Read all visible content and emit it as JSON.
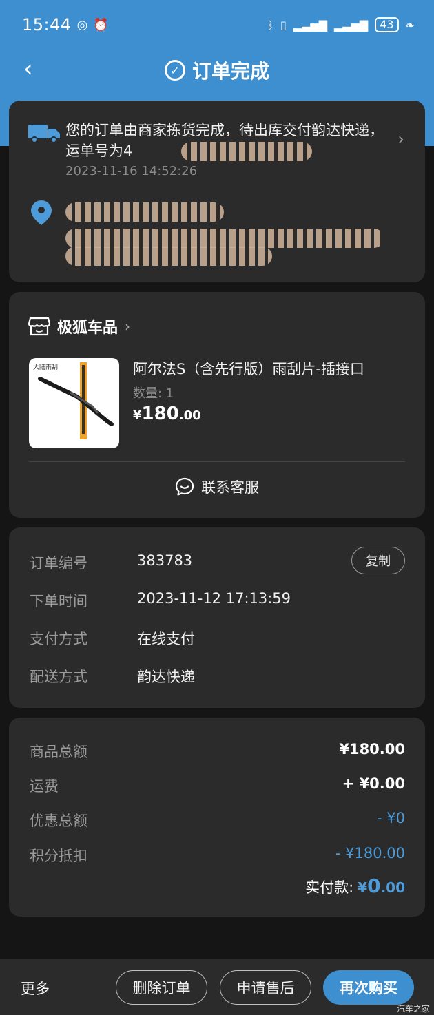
{
  "status_bar": {
    "time": "15:44",
    "battery": "43"
  },
  "header": {
    "title": "订单完成"
  },
  "logistics": {
    "message": "您的订单由商家拣货完成，待出库交付韵达快递，运单号为4",
    "timestamp": "2023-11-16 14:52:26"
  },
  "store": {
    "name": "极狐车品"
  },
  "product": {
    "name": "阿尔法S（含先行版）雨刮片-插接口",
    "quantity": "数量: 1",
    "price_currency": "¥",
    "price_int": "180",
    "price_dec": ".00",
    "image_label": "大陆雨刮"
  },
  "contact_service": "联系客服",
  "order_info": {
    "copy_label": "复制",
    "rows": [
      {
        "label": "订单编号",
        "value": "383783"
      },
      {
        "label": "下单时间",
        "value": "2023-11-12 17:13:59"
      },
      {
        "label": "支付方式",
        "value": "在线支付"
      },
      {
        "label": "配送方式",
        "value": "韵达快递"
      }
    ]
  },
  "amounts": {
    "rows": [
      {
        "label": "商品总额",
        "value": "¥180.00"
      },
      {
        "label": "运费",
        "value": "+ ¥0.00"
      },
      {
        "label": "优惠总额",
        "value": "- ¥0"
      },
      {
        "label": "积分抵扣",
        "value": "- ¥180.00"
      }
    ],
    "paid_label": "实付款:",
    "paid_currency": "¥",
    "paid_int": "0",
    "paid_dec": ".00"
  },
  "bottom_bar": {
    "more": "更多",
    "delete": "删除订单",
    "after_sale": "申请售后",
    "buy_again": "再次购买"
  },
  "watermark": "汽车之家",
  "colors": {
    "accent": "#3d8fd0",
    "card": "#2b2b2b",
    "price_blue": "#4d9bd8"
  }
}
